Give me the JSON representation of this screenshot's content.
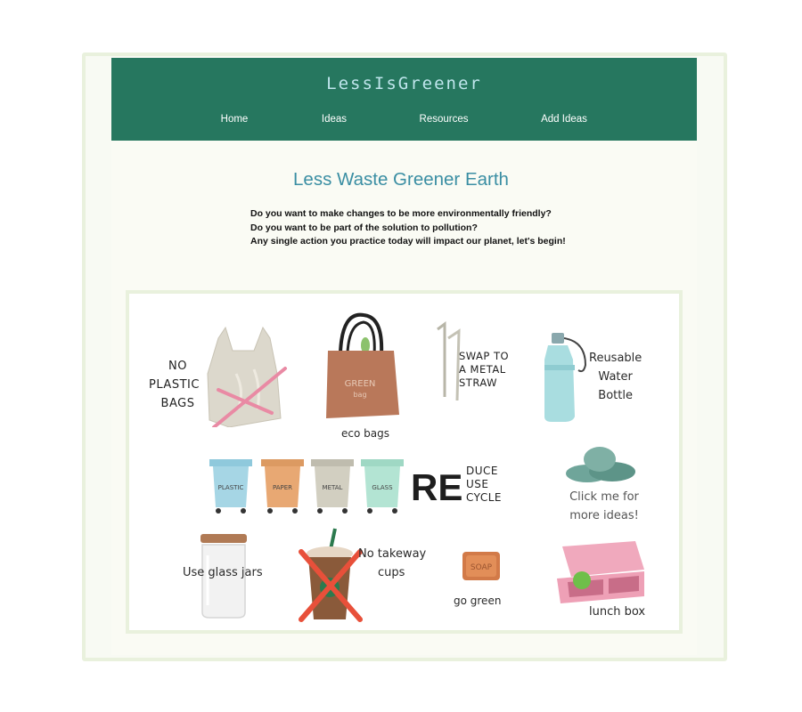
{
  "brand": {
    "logo_text": "LessIsGreener"
  },
  "nav": {
    "items": [
      {
        "label": "Home"
      },
      {
        "label": "Ideas"
      },
      {
        "label": "Resources"
      },
      {
        "label": "Add Ideas"
      }
    ]
  },
  "page": {
    "title": "Less Waste Greener Earth",
    "intro_lines": [
      "Do you want to make changes to be more environmentally friendly?",
      "Do you want to be part of the solution to pollution?",
      "Any single action you practice today will impact our planet, let's begin!"
    ]
  },
  "ideas": {
    "no_plastic": [
      "NO",
      "PLASTIC",
      "BAGS"
    ],
    "eco_bags": "eco bags",
    "eco_bag_print": [
      "GREEN",
      "bag"
    ],
    "straw": [
      "SWAP TO",
      "A METAL",
      "STRAW"
    ],
    "bottle": [
      "Reusable",
      "Water",
      "Bottle"
    ],
    "bins": [
      "PLASTIC",
      "PAPER",
      "METAL",
      "GLASS"
    ],
    "re_big": "RE",
    "re_words": [
      "DUCE",
      "USE",
      "CYCLE"
    ],
    "click_more": [
      "Click me for",
      "more ideas!"
    ],
    "glass_jars": "Use glass jars",
    "takeaway": [
      "No takeway",
      "cups"
    ],
    "soap_label": "SOAP",
    "go_green": "go green",
    "lunch_box": "lunch box"
  },
  "colors": {
    "header_bg": "#26775f",
    "logo": "#bfe5ec",
    "title": "#3a8ea3",
    "frame": "#e9f1dd",
    "content_bg": "#fafbf4"
  }
}
